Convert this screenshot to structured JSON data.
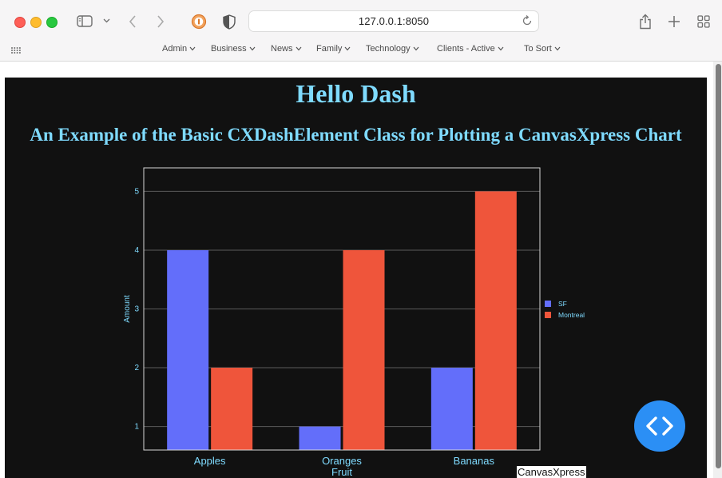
{
  "browser": {
    "url": "127.0.0.1:8050",
    "bookmarks": [
      "Admin",
      "Business",
      "News",
      "Family",
      "Technology",
      "Clients - Active",
      "To Sort"
    ]
  },
  "page": {
    "title": "Hello Dash",
    "subtitle": "An Example of the Basic CXDashElement Class for Plotting a CanvasXpress Chart",
    "credit": "CanvasXpress"
  },
  "colors": {
    "heading": "#7fdbff",
    "background": "#111111",
    "sf": "#636efa",
    "montreal": "#ef553b",
    "fab": "#2b8ff5"
  },
  "icons": {
    "fab": "code-icon"
  },
  "chart_data": {
    "type": "bar",
    "categories": [
      "Apples",
      "Oranges",
      "Bananas"
    ],
    "series": [
      {
        "name": "SF",
        "values": [
          4,
          1,
          2
        ],
        "color": "#636efa"
      },
      {
        "name": "Montreal",
        "values": [
          2,
          4,
          5
        ],
        "color": "#ef553b"
      }
    ],
    "xlabel": "Fruit",
    "ylabel": "Amount",
    "ylim": [
      0.6,
      5.4
    ],
    "yticks": [
      1,
      2,
      3,
      4,
      5
    ],
    "legend": "right",
    "grid": true
  }
}
